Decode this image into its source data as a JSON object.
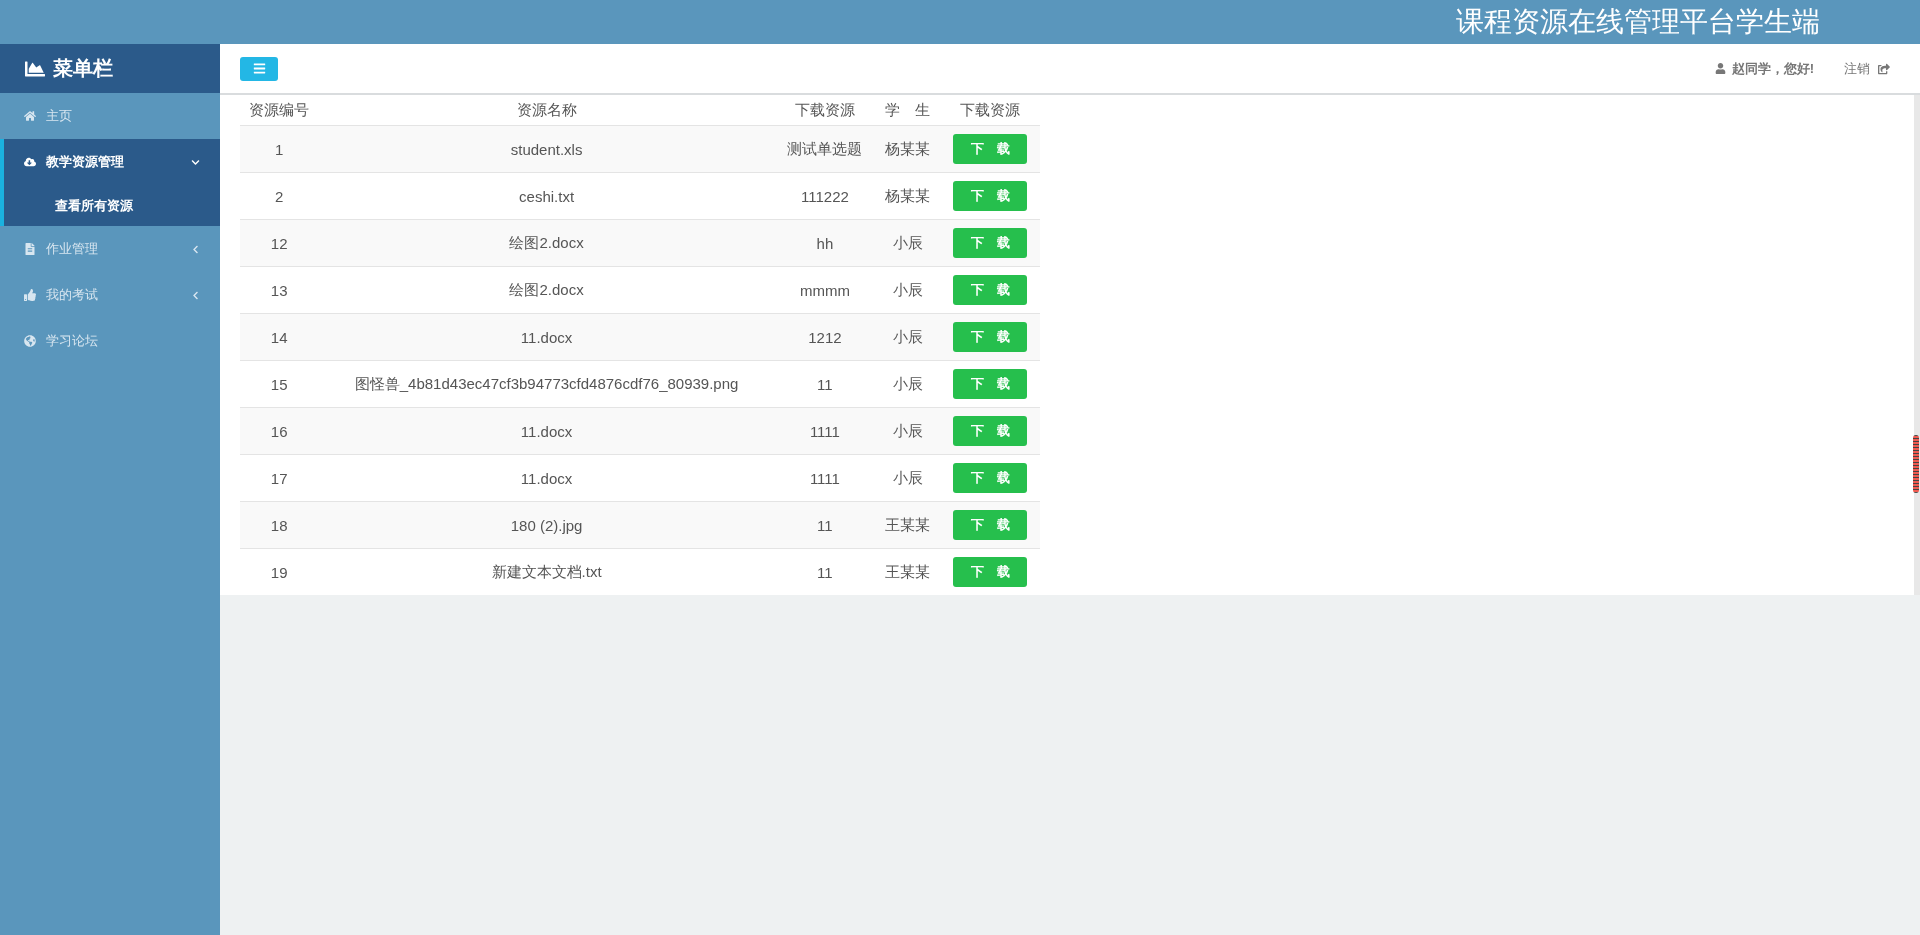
{
  "app_title": "课程资源在线管理平台学生端",
  "sidebar": {
    "heading": "菜单栏",
    "items": [
      {
        "label": "主页",
        "selected": false
      },
      {
        "label": "教学资源管理",
        "selected": true,
        "expanded": true,
        "children": [
          {
            "label": "查看所有资源",
            "selected": true
          }
        ]
      },
      {
        "label": "作业管理",
        "selected": false,
        "expanded": false
      },
      {
        "label": "我的考试",
        "selected": false,
        "expanded": false
      },
      {
        "label": "学习论坛",
        "selected": false
      }
    ]
  },
  "header": {
    "greeting": "赵同学，您好!",
    "logout": "注销"
  },
  "table": {
    "columns": [
      "资源编号",
      "资源名称",
      "下载资源",
      "学　生",
      "下载资源"
    ],
    "rows": [
      {
        "id": "1",
        "name": "student.xls",
        "resource": "测试单选题",
        "student": "杨某某",
        "action": "下　载"
      },
      {
        "id": "2",
        "name": "ceshi.txt",
        "resource": "111222",
        "student": "杨某某",
        "action": "下　载"
      },
      {
        "id": "12",
        "name": "绘图2.docx",
        "resource": "hh",
        "student": "小辰",
        "action": "下　载"
      },
      {
        "id": "13",
        "name": "绘图2.docx",
        "resource": "mmmm",
        "student": "小辰",
        "action": "下　载"
      },
      {
        "id": "14",
        "name": "11.docx",
        "resource": "1212",
        "student": "小辰",
        "action": "下　载"
      },
      {
        "id": "15",
        "name": "图怪兽_4b81d43ec47cf3b94773cfd4876cdf76_80939.png",
        "resource": "11",
        "student": "小辰",
        "action": "下　载"
      },
      {
        "id": "16",
        "name": "11.docx",
        "resource": "1111",
        "student": "小辰",
        "action": "下　载"
      },
      {
        "id": "17",
        "name": "11.docx",
        "resource": "1111",
        "student": "小辰",
        "action": "下　载"
      },
      {
        "id": "18",
        "name": "180 (2).jpg",
        "resource": "11",
        "student": "王某某",
        "action": "下　载"
      },
      {
        "id": "19",
        "name": "新建文本文档.txt",
        "resource": "11",
        "student": "王某某",
        "action": "下　载"
      }
    ]
  }
}
